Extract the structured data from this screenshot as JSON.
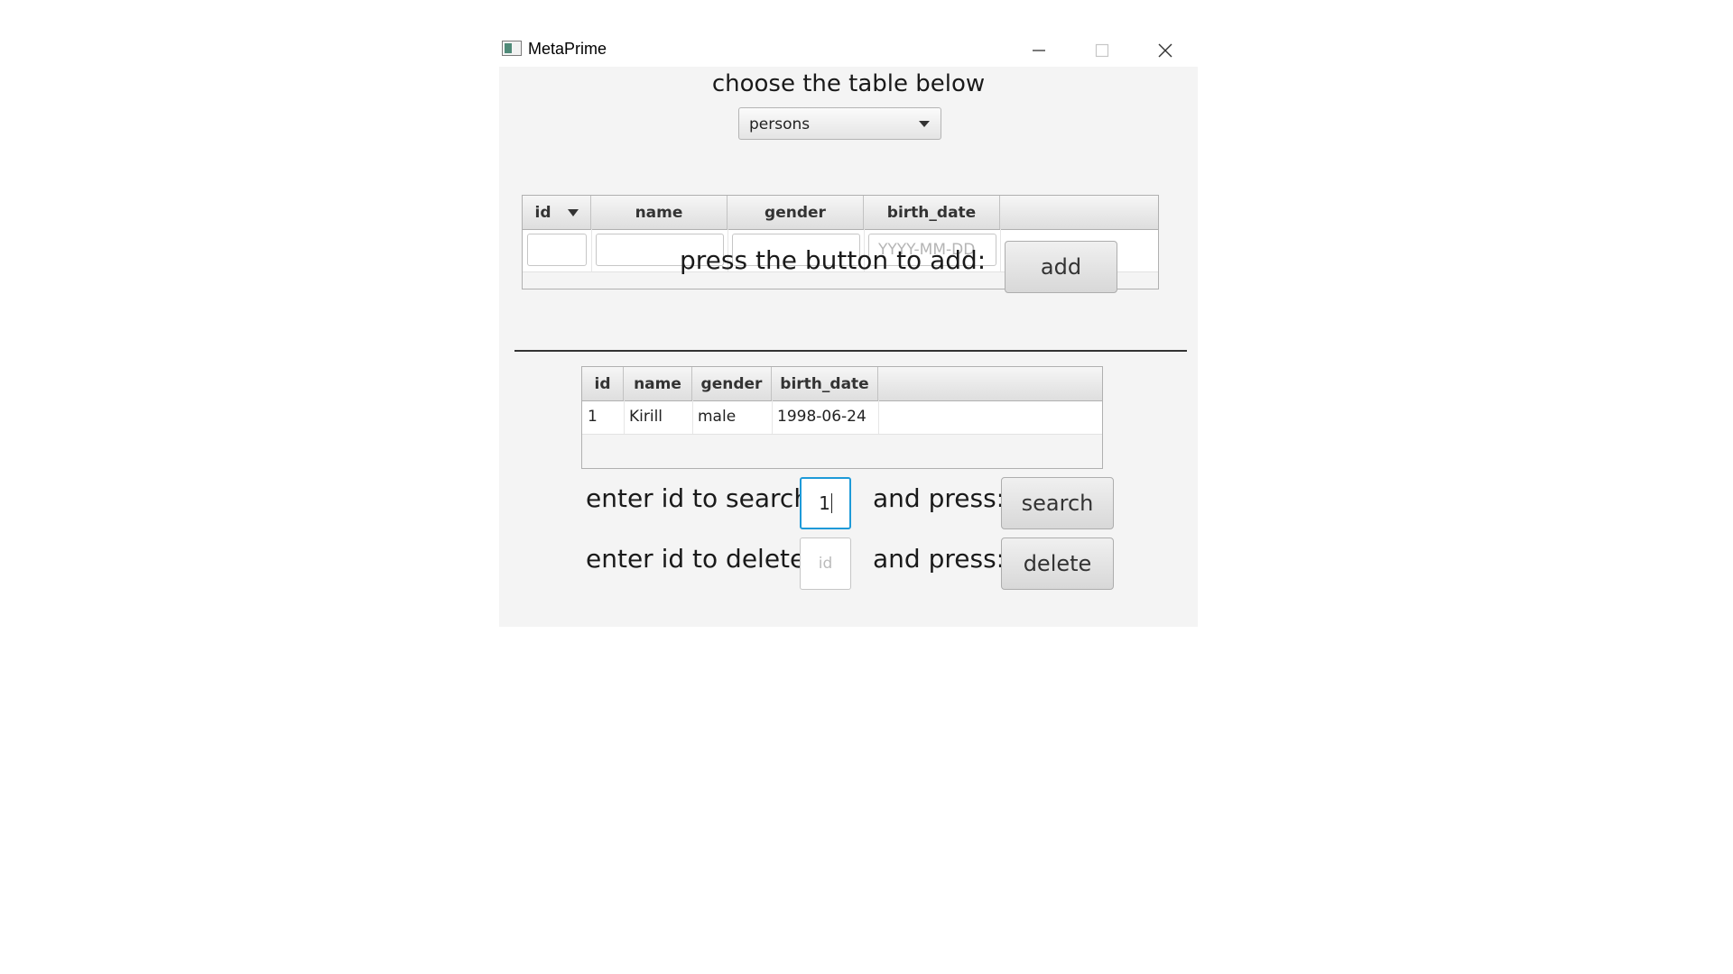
{
  "window": {
    "title": "MetaPrime",
    "icons": {
      "app": "app-icon",
      "minimize": "minimize-icon",
      "maximize": "maximize-icon",
      "close": "close-icon"
    }
  },
  "main": {
    "choose_label": "choose the table below",
    "table_select": {
      "value": "persons",
      "icon": "chevron-down-icon"
    }
  },
  "input_table": {
    "columns": [
      "id",
      "name",
      "gender",
      "birth_date"
    ],
    "sorted_column": "id",
    "sort_icon": "sort-descending-icon",
    "inputs": [
      {
        "column": "id",
        "value": "",
        "placeholder": ""
      },
      {
        "column": "name",
        "value": "",
        "placeholder": ""
      },
      {
        "column": "gender",
        "value": "",
        "placeholder": ""
      },
      {
        "column": "birth_date",
        "value": "",
        "placeholder": "YYYY-MM-DD"
      }
    ]
  },
  "add_section": {
    "label": "press the button to add:",
    "button": "add"
  },
  "results_table": {
    "columns": [
      "id",
      "name",
      "gender",
      "birth_date"
    ],
    "rows": [
      [
        "1",
        "Kirill",
        "male",
        "1998-06-24"
      ]
    ]
  },
  "search_section": {
    "label": "enter id to search",
    "input_value": "1",
    "press_label": "and press:",
    "button": "search"
  },
  "delete_section": {
    "label": "enter id to delete",
    "input_placeholder": "id",
    "press_label": "and press:",
    "button": "delete"
  },
  "colors": {
    "background": "#f4f4f4",
    "focus_border": "#1e9ad8",
    "separator": "#333333"
  }
}
